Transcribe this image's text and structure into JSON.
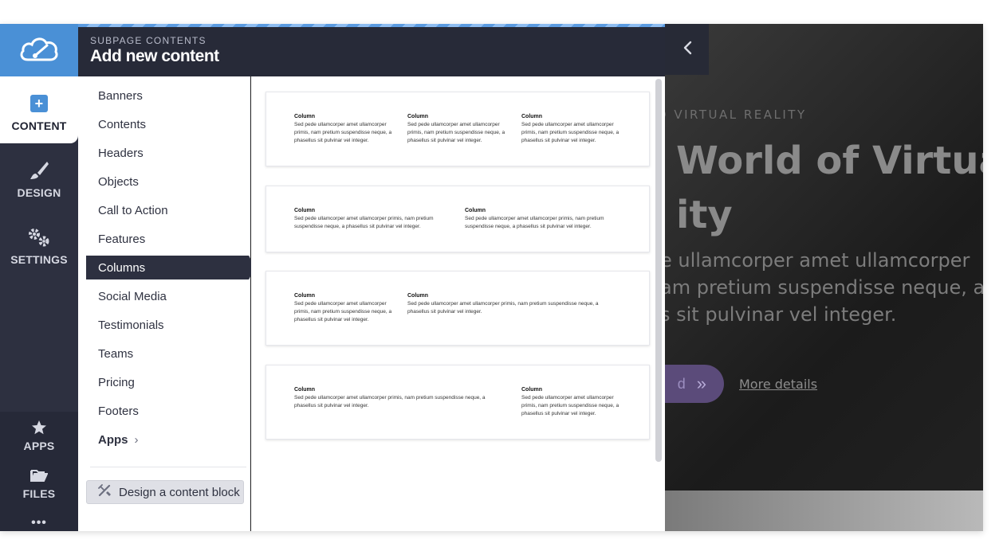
{
  "rail": {
    "content_label": "CONTENT",
    "design_label": "DESIGN",
    "settings_label": "SETTINGS",
    "apps_label": "APPS",
    "files_label": "FILES",
    "more_label": "•••"
  },
  "header": {
    "subtitle": "SUBPAGE CONTENTS",
    "title": "Add new content"
  },
  "categories": [
    "Banners",
    "Contents",
    "Headers",
    "Objects",
    "Call to Action",
    "Features",
    "Columns",
    "Social Media",
    "Testimonials",
    "Teams",
    "Pricing",
    "Footers",
    "Apps"
  ],
  "active_category": "Columns",
  "design_block_label": "Design a content block",
  "templates": {
    "col_heading": "Column",
    "short_text": "Sed pede ullamcorper amet ullamcorper primis, nam pretium suspendisse neque, a phasellus sit pulvinar vel integer.",
    "long_text": "Sed pede ullamcorper amet ullamcorper primis, nam pretium suspendisse neque, a phasellus sit pulvinar vel integer."
  },
  "hero": {
    "eyebrow": "D VIRTUAL REALITY",
    "title_line1": "World of Virtua",
    "title_line2": "ity",
    "text_line1": "e ullamcorper amet ullamcorper",
    "text_line2": "am pretium suspendisse neque, a",
    "text_line3": "s sit pulvinar vel integer.",
    "button_label": "d",
    "link_label": "More details"
  },
  "colors": {
    "brand_blue": "#4a90d6",
    "sidebar_dark": "#2d3040",
    "header_dark": "#272a38"
  }
}
